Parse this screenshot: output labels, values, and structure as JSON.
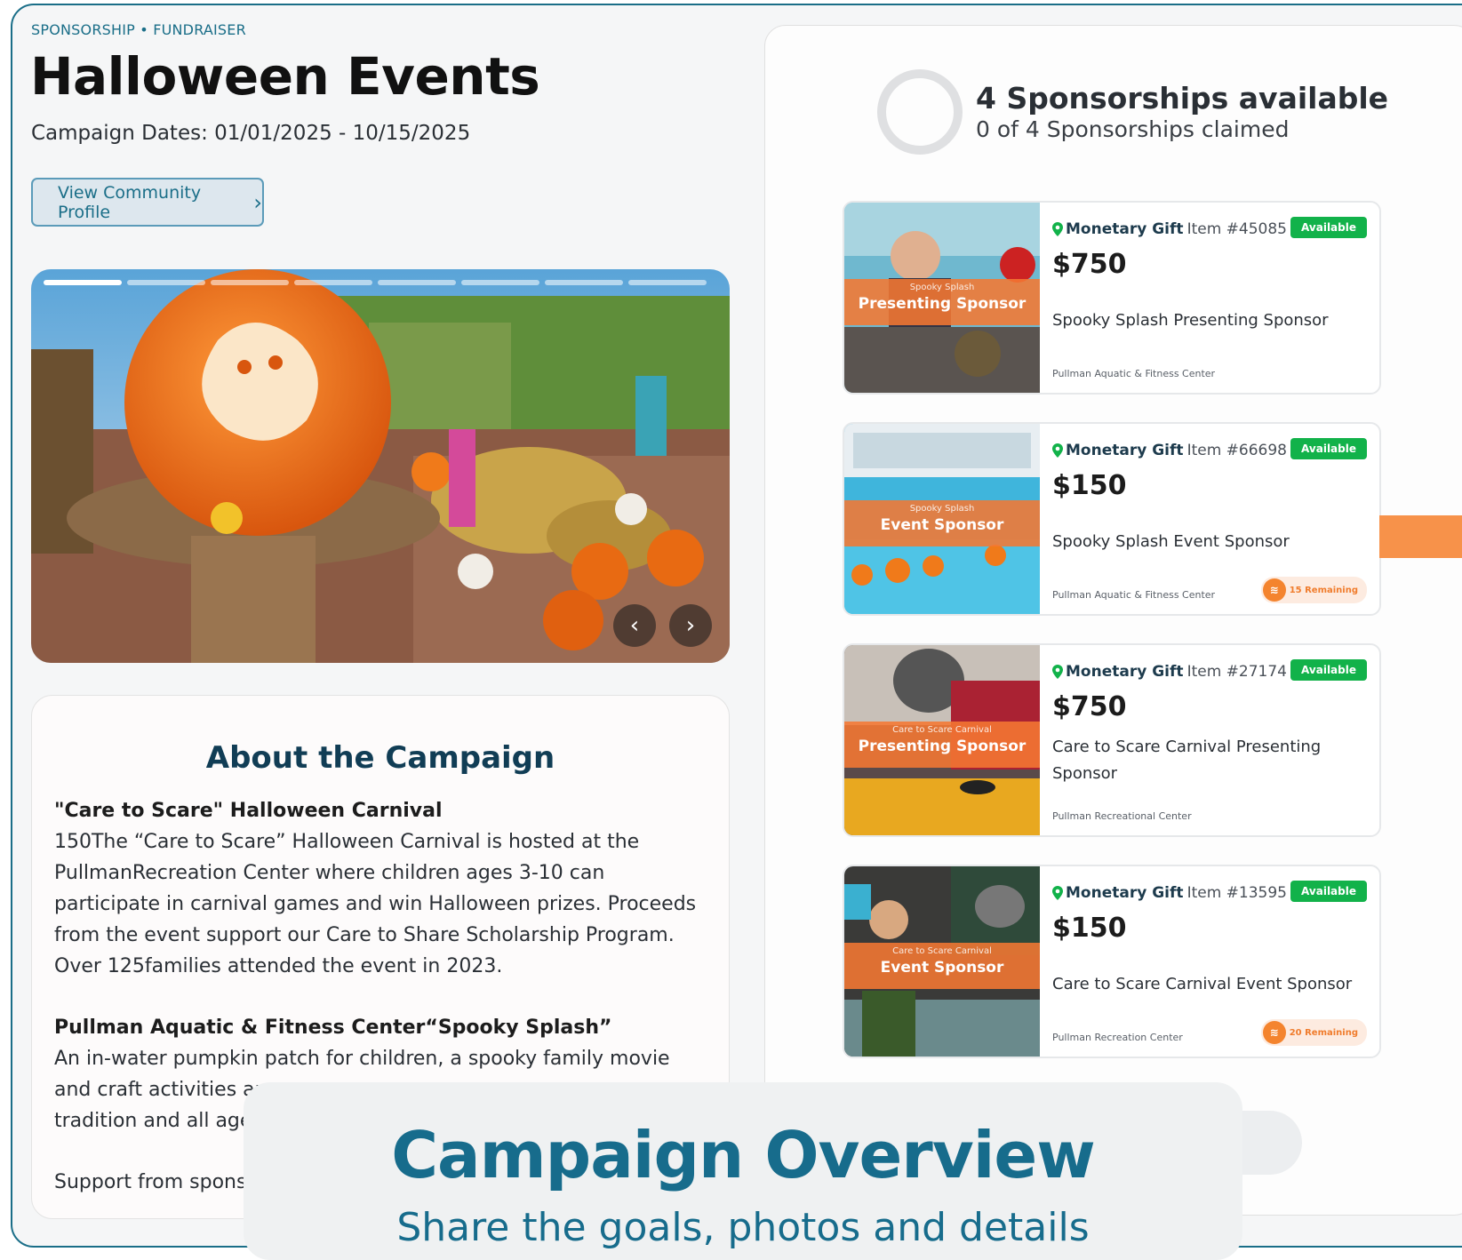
{
  "header": {
    "tagline": "SPONSORSHIP • FUNDRAISER",
    "title": "Halloween Events",
    "dates": "Campaign Dates: 01/01/2025 - 10/15/2025",
    "profile_button": "View Community Profile",
    "profile_chevron": "›"
  },
  "carousel": {
    "slides": 8,
    "active_slide": 1,
    "prev": "‹",
    "next": "›"
  },
  "about": {
    "heading": "About the Campaign",
    "sections": [
      {
        "heading": "\"Care to Scare\" Halloween Carnival",
        "text": "150The “Care to Scare” Halloween Carnival is hosted at the PullmanRecreation Center where children ages 3-10 can participate in carnival games and win Halloween prizes. Proceeds from the event support our Care to Share Scholarship Program. Over 125families attended the event in 2023."
      },
      {
        "heading": "Pullman Aquatic & Fitness Center“Spooky Splash”",
        "text": "An in-water pumpkin patch for children, a spooky family movie and craft activities are pr"
      }
    ],
    "line3_visible": "tradition and all age",
    "line4_visible": "Support from spons"
  },
  "sponsorships": {
    "title": "4 Sponsorships available",
    "subtitle": "0 of 4 Sponsorships claimed",
    "claimed": 0,
    "total": 4,
    "items": [
      {
        "type": "Monetary Gift",
        "item_no": "Item #45085",
        "badge": "Available",
        "price": "$750",
        "name": "Spooky Splash Presenting Sponsor",
        "venue": "Pullman Aquatic & Fitness Center",
        "banner_small": "Spooky Splash",
        "banner_big": "Presenting Sponsor",
        "remaining": ""
      },
      {
        "type": "Monetary Gift",
        "item_no": "Item #66698",
        "badge": "Available",
        "price": "$150",
        "name": "Spooky Splash Event Sponsor",
        "venue": "Pullman Aquatic & Fitness Center",
        "banner_small": "Spooky Splash",
        "banner_big": "Event Sponsor",
        "remaining": "15 Remaining"
      },
      {
        "type": "Monetary Gift",
        "item_no": "Item #27174",
        "badge": "Available",
        "price": "$750",
        "name": "Care to Scare Carnival Presenting Sponsor",
        "venue": "Pullman Recreational Center",
        "banner_small": "Care to Scare Carnival",
        "banner_big": "Presenting Sponsor",
        "remaining": ""
      },
      {
        "type": "Monetary Gift",
        "item_no": "Item #13595",
        "badge": "Available",
        "price": "$150",
        "name": "Care to Scare Carnival Event Sponsor",
        "venue": "Pullman Recreation Center",
        "banner_small": "Care to Scare Carnival",
        "banner_big": "Event Sponsor",
        "remaining": "20 Remaining"
      }
    ]
  },
  "overlay": {
    "title": "Campaign Overview",
    "subtitle": "Share the goals, photos and details"
  },
  "colors": {
    "accent": "#1a6e88",
    "available": "#12b24a",
    "orange": "#f4842e"
  },
  "icons": [
    "chevron-right-icon",
    "location-pin-icon",
    "ticket-icon",
    "chevron-left-icon"
  ]
}
